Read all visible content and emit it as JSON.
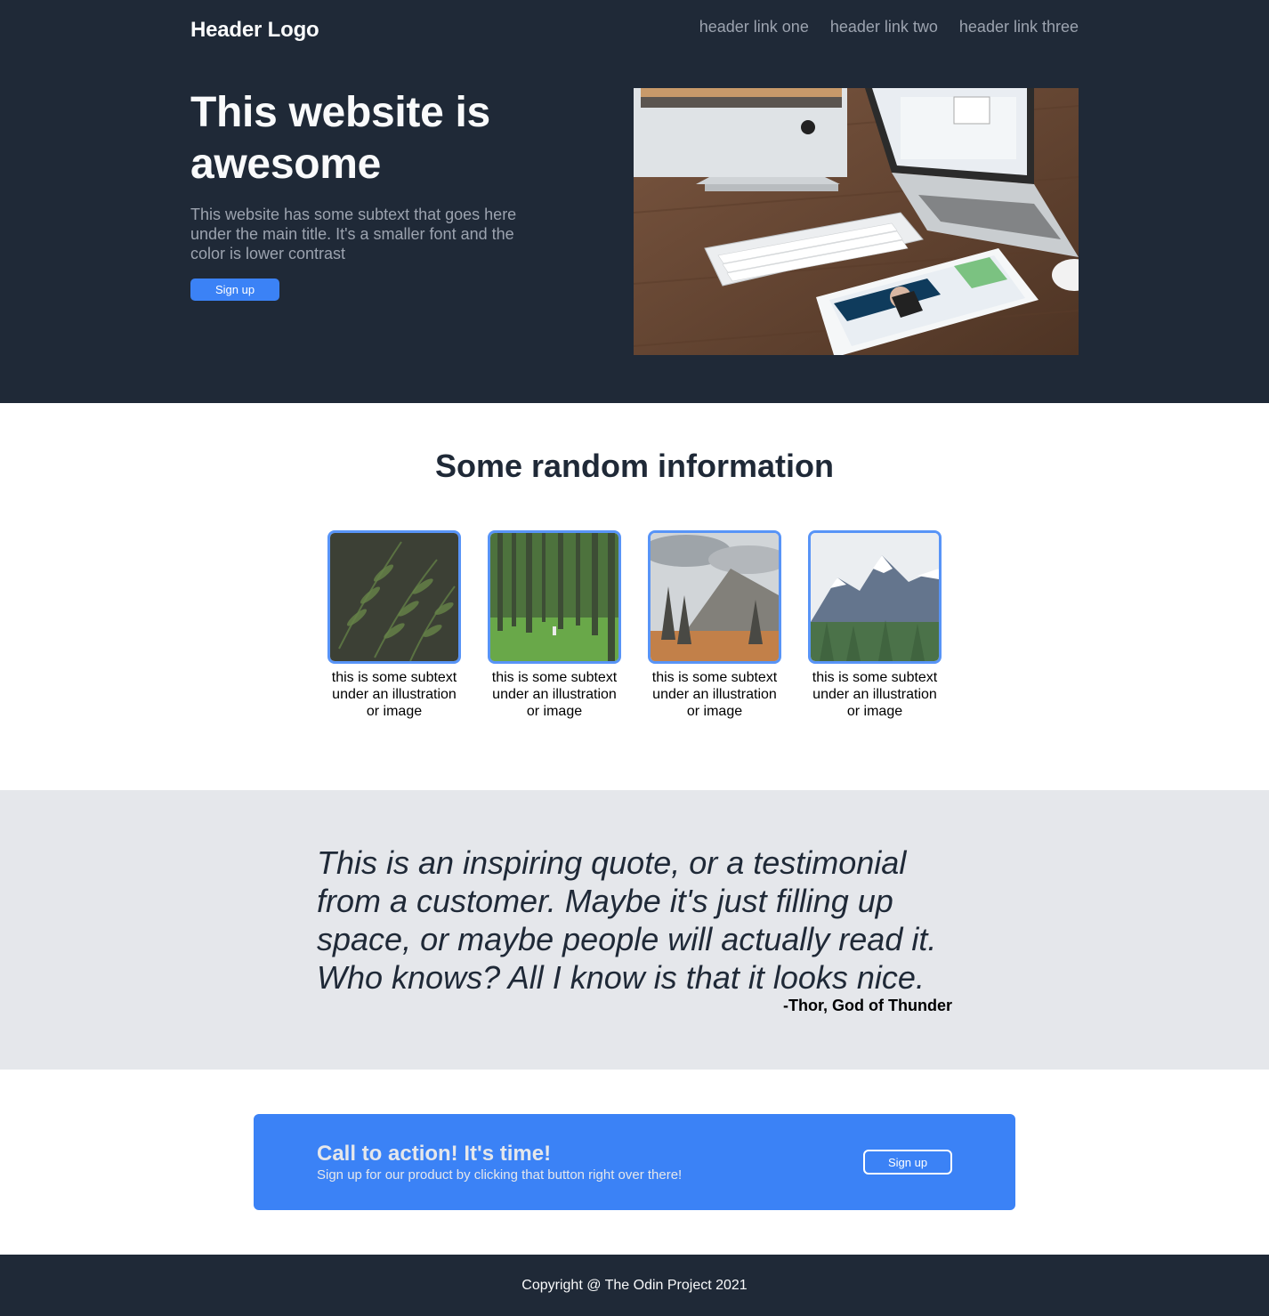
{
  "header": {
    "logo": "Header Logo",
    "links": [
      "header link one",
      "header link two",
      "header link three"
    ]
  },
  "hero": {
    "title": "This website is awesome",
    "subtext": "This website has some subtext that goes here under the main title. It's a smaller font and the color is lower contrast",
    "button_label": "Sign up",
    "image_subject": "desk-with-computers-image"
  },
  "info": {
    "title": "Some random information",
    "cards": [
      {
        "caption": "this is some subtext under an illustration or image",
        "image": "fern-leaves-image"
      },
      {
        "caption": "this is some subtext under an illustration or image",
        "image": "green-forest-image"
      },
      {
        "caption": "this is some subtext under an illustration or image",
        "image": "mountain-valley-image"
      },
      {
        "caption": "this is some subtext under an illustration or image",
        "image": "snowy-mountain-image"
      }
    ]
  },
  "quote": {
    "text": "This is an inspiring quote, or a testimonial from a customer. Maybe it's just filling up space, or maybe people will actually read it. Who knows? All I know is that it looks nice.",
    "author": "-Thor, God of Thunder"
  },
  "cta": {
    "title": "Call to action! It's time!",
    "subtext": "Sign up for our product by clicking that button right over there!",
    "button_label": "Sign up"
  },
  "footer": {
    "copyright": "Copyright @ The Odin Project 2021"
  },
  "colors": {
    "dark": "#1f2937",
    "accent": "#3b82f6",
    "muted": "#9ca3af",
    "quote_bg": "#e5e7eb"
  }
}
